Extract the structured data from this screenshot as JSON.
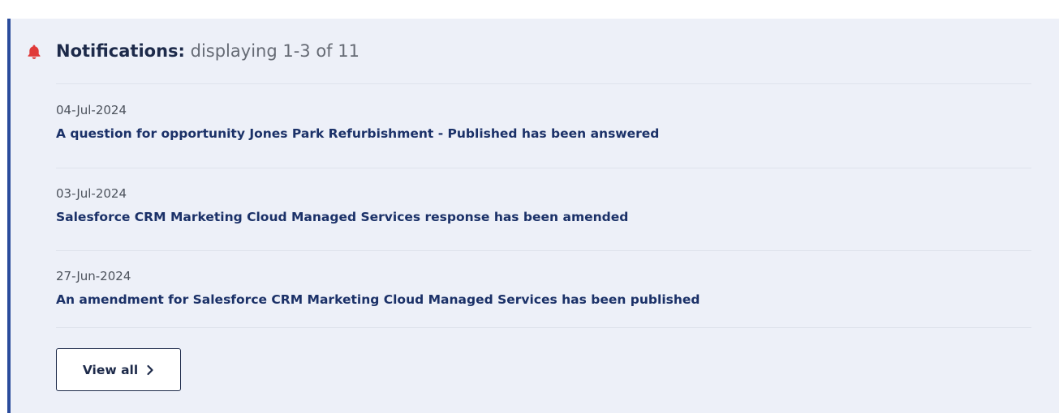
{
  "notifications": {
    "label": "Notifications:",
    "summary": "displaying 1-3 of 11",
    "items": [
      {
        "date": "04-Jul-2024",
        "text": "A question for opportunity Jones Park Refurbishment - Published has been answered"
      },
      {
        "date": "03-Jul-2024",
        "text": "Salesforce CRM Marketing Cloud Managed Services response has been amended"
      },
      {
        "date": "27-Jun-2024",
        "text": "An amendment for Salesforce CRM Marketing Cloud Managed Services has been published"
      }
    ],
    "view_all_label": "View all"
  },
  "icons": {
    "header": "bell-icon",
    "view_all": "chevron-right-icon"
  },
  "colors": {
    "accent_border": "#2a4c9c",
    "bell": "#e03a3a",
    "panel_background": "#edf0f8",
    "link_text": "#1b3168"
  }
}
